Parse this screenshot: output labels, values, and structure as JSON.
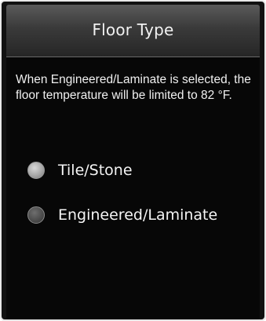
{
  "header": {
    "title": "Floor Type"
  },
  "message": "When Engineered/Laminate is selected, the floor temperature will be limited to 82 °F.",
  "options": [
    {
      "label": "Tile/Stone",
      "selected": true
    },
    {
      "label": "Engineered/Laminate",
      "selected": false
    }
  ],
  "colors": {
    "background": "#070707",
    "header_top": "#5a5a5a",
    "header_bottom": "#262626",
    "text": "#f0f0f0",
    "frame": "#e8e8e8"
  }
}
